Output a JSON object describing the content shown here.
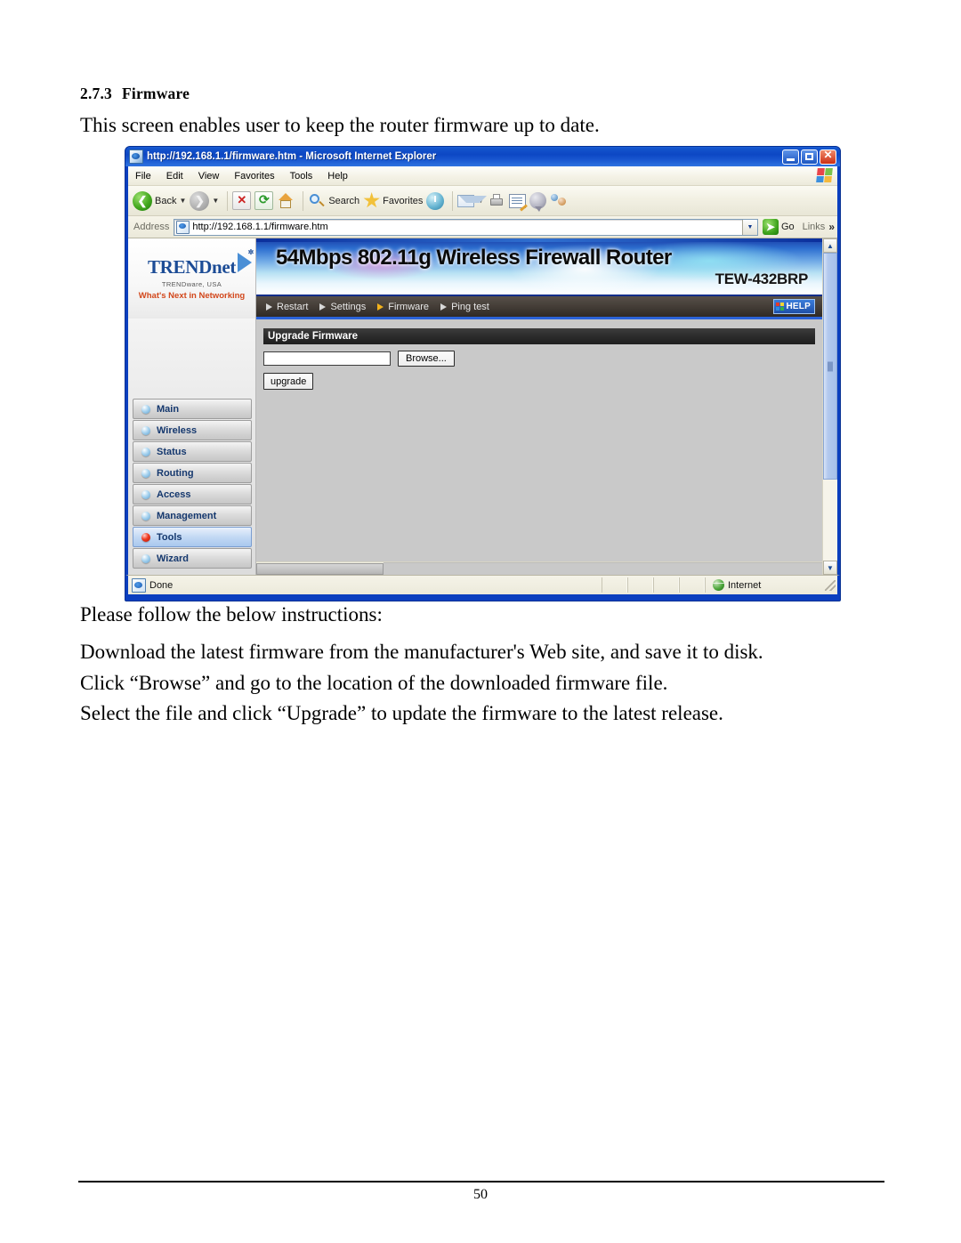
{
  "document": {
    "section_number": "2.7.3",
    "section_title": "Firmware",
    "intro": "This screen enables user to keep the router firmware up to date.",
    "instructions_lead": "Please follow the below instructions:",
    "instruction_1": "Download the latest firmware from the manufacturer's Web site, and save it to disk.",
    "instruction_2": "Click “Browse” and go to the location of the downloaded firmware file.",
    "instruction_3": "Select the file and click “Upgrade” to update the firmware to the latest release.",
    "page_number": "50"
  },
  "browser": {
    "title": "http://192.168.1.1/firmware.htm - Microsoft Internet Explorer",
    "window_buttons": {
      "minimize": "minimize",
      "maximize": "maximize",
      "close": "close"
    },
    "menus": [
      "File",
      "Edit",
      "View",
      "Favorites",
      "Tools",
      "Help"
    ],
    "toolbar": {
      "back_label": "Back",
      "forward_label": "",
      "stop_label": "",
      "refresh_label": "",
      "home_label": "",
      "search_label": "Search",
      "favorites_label": "Favorites",
      "history_label": "",
      "mail_label": "",
      "print_label": "",
      "edit_label": "",
      "discuss_label": "",
      "messenger_label": ""
    },
    "address": {
      "label": "Address",
      "url": "http://192.168.1.1/firmware.htm",
      "go_label": "Go",
      "links_label": "Links",
      "more_label": "»"
    },
    "status": {
      "text": "Done",
      "zone": "Internet"
    }
  },
  "router_page": {
    "logo": {
      "brand": "TRENDnet",
      "company": "TRENDware, USA",
      "tagline": "What's Next in Networking"
    },
    "banner": {
      "title": "54Mbps 802.11g Wireless Firewall Router",
      "model": "TEW-432BRP"
    },
    "nav": [
      {
        "label": "Restart",
        "active": false
      },
      {
        "label": "Settings",
        "active": false
      },
      {
        "label": "Firmware",
        "active": true
      },
      {
        "label": "Ping test",
        "active": false
      }
    ],
    "help_label": "HELP",
    "sidebar": [
      {
        "label": "Main",
        "active": false
      },
      {
        "label": "Wireless",
        "active": false
      },
      {
        "label": "Status",
        "active": false
      },
      {
        "label": "Routing",
        "active": false
      },
      {
        "label": "Access",
        "active": false
      },
      {
        "label": "Management",
        "active": false
      },
      {
        "label": "Tools",
        "active": true
      },
      {
        "label": "Wizard",
        "active": false
      }
    ],
    "content": {
      "section_title": "Upgrade Firmware",
      "file_value": "",
      "browse_label": "Browse...",
      "upgrade_label": "upgrade"
    }
  },
  "colors": {
    "title_bar": "#0d47c4",
    "window_border": "#0b3fbf",
    "sidebar_label": "#15386e",
    "brand_blue": "#1c4c96",
    "tagline_orange": "#d2471b",
    "nav_strip": "#3a332d",
    "section_head": "#2b2b2b",
    "active_dot": "#ef3a22"
  }
}
